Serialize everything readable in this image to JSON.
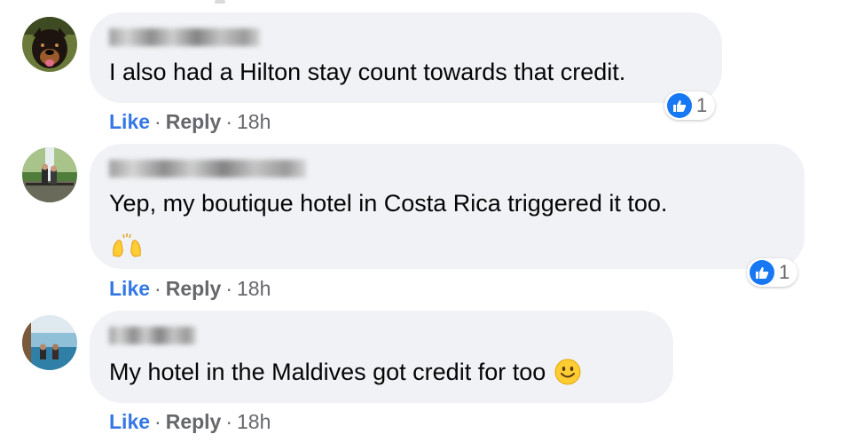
{
  "comments": [
    {
      "text": "I also had a Hilton stay count towards that credit.",
      "reaction_count": "1",
      "actions": {
        "like": "Like",
        "separator": "·",
        "reply": "Reply",
        "time": "18h"
      }
    },
    {
      "text": "Yep, my boutique hotel in Costa Rica triggered it too.",
      "emoji": "raising-hands-emoji",
      "reaction_count": "1",
      "actions": {
        "like": "Like",
        "separator": "·",
        "reply": "Reply",
        "time": "18h"
      }
    },
    {
      "text": "My hotel in the Maldives got credit for too",
      "emoji": "smiling-face-emoji",
      "actions": {
        "like": "Like",
        "separator": "·",
        "reply": "Reply",
        "time": "18h"
      }
    }
  ],
  "colors": {
    "bubble": "#f0f2f5",
    "like_blue": "#3578e5",
    "reaction_blue": "#1877f2",
    "meta_gray": "#65676b"
  },
  "icons": [
    "dog-avatar",
    "waterfall-avatar",
    "pool-avatar",
    "thumbs-up-icon"
  ]
}
